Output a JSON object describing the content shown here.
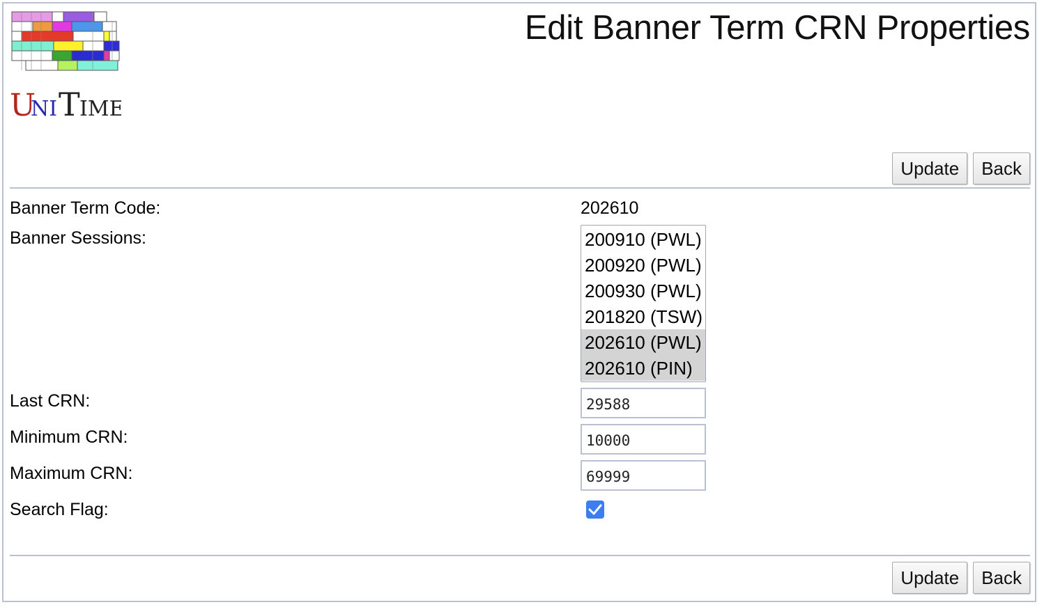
{
  "page": {
    "title": "Edit Banner Term CRN Properties"
  },
  "logo": {
    "text": "UniTime"
  },
  "buttons": {
    "update": "Update",
    "back": "Back"
  },
  "form": {
    "term_code_label": "Banner Term Code:",
    "term_code_value": "202610",
    "sessions_label": "Banner Sessions:",
    "sessions": [
      {
        "label": "200910 (PWL)",
        "selected": false
      },
      {
        "label": "200920 (PWL)",
        "selected": false
      },
      {
        "label": "200930 (PWL)",
        "selected": false
      },
      {
        "label": "201820 (TSW)",
        "selected": false
      },
      {
        "label": "202610 (PWL)",
        "selected": true
      },
      {
        "label": "202610 (PIN)",
        "selected": true
      }
    ],
    "last_crn_label": "Last CRN:",
    "last_crn_value": "29588",
    "min_crn_label": "Minimum CRN:",
    "min_crn_value": "10000",
    "max_crn_label": "Maximum CRN:",
    "max_crn_value": "69999",
    "search_flag_label": "Search Flag:",
    "search_flag_checked": true
  },
  "colors": {
    "border": "#b9c1d2",
    "checkbox": "#3c7ef0",
    "selected_option": "#d4d4d4"
  }
}
